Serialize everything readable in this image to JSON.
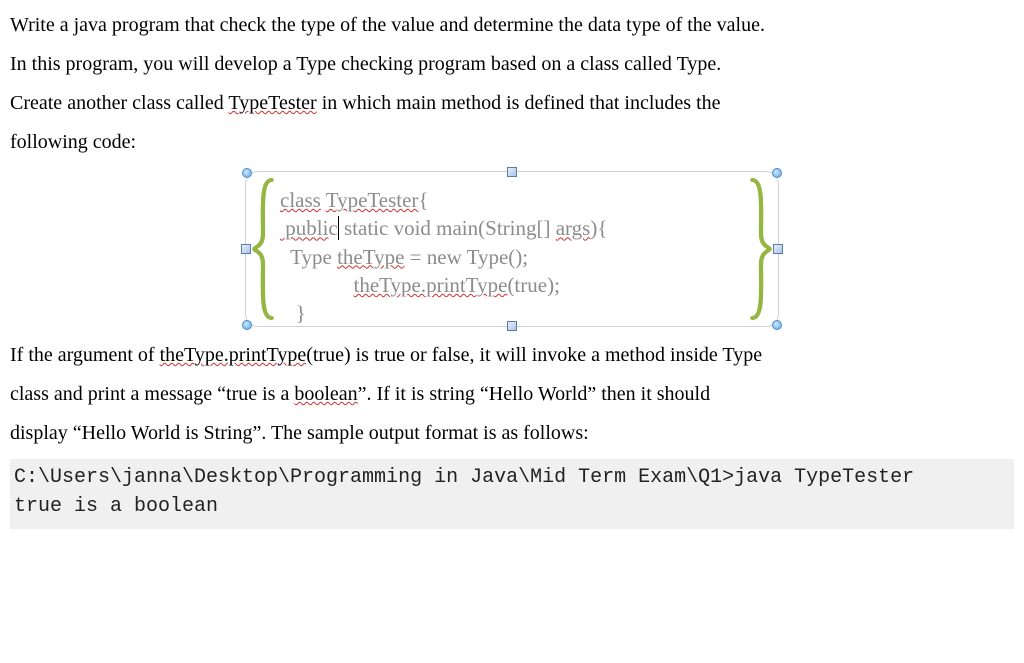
{
  "intro": {
    "line1_pre": "Write a java program that check the type of the value and determine the data type of the value.",
    "line2": "In this program, you will develop a Type checking program based on a class called Type.",
    "line3_a": "Create another class called ",
    "line3_b": "TypeTester",
    "line3_c": " in which main method is defined that includes the",
    "line4": "following code:"
  },
  "code": {
    "l1a": "class",
    "l1b": " ",
    "l1c": "TypeTester",
    "l1d": "{",
    "l2a": " publi",
    "l2b": "c",
    "l2c": " static void main(String[] ",
    "l2d": "args",
    "l2e": "){",
    "l3a": "  Type ",
    "l3b": "theType",
    "l3c": " = new Type();",
    "l4a": "              ",
    "l4b": "theType.printType",
    "l4c": "(true);",
    "l5": "   }"
  },
  "after": {
    "p1a": "If the argument of ",
    "p1b": "theType.printType",
    "p1c": "(true) is true or false, it will invoke a method inside Type",
    "p2a": "class and print a message “true is a ",
    "p2b": "boolean",
    "p2c": "”. If it is string “Hello World” then it should",
    "p3": "display “Hello World is String”. The sample output format is as follows:"
  },
  "terminal": {
    "line1": "C:\\Users\\janna\\Desktop\\Programming in Java\\Mid Term Exam\\Q1>java TypeTester",
    "line2": "true is a boolean"
  }
}
